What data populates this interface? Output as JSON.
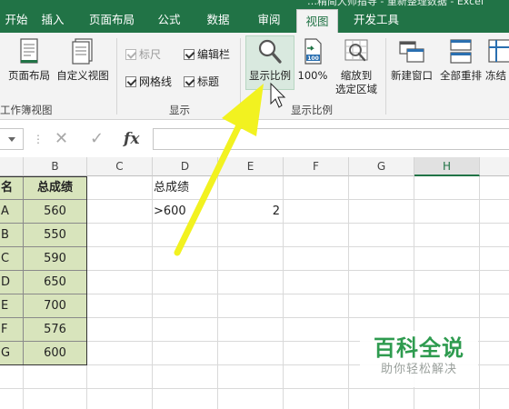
{
  "window": {
    "title": "…精简大师指导 - 重新整理数据 - Excel"
  },
  "tabs": [
    {
      "label": "开始",
      "active": false
    },
    {
      "label": "插入",
      "active": false
    },
    {
      "label": "页面布局",
      "active": false
    },
    {
      "label": "公式",
      "active": false
    },
    {
      "label": "数据",
      "active": false
    },
    {
      "label": "审阅",
      "active": false
    },
    {
      "label": "视图",
      "active": true
    },
    {
      "label": "开发工具",
      "active": false
    }
  ],
  "ribbon": {
    "workbook_views": {
      "page_layout_label": "页面布局",
      "custom_view_label": "自定义视图",
      "group_label": "工作簿视图"
    },
    "show": {
      "ruler_label": "标尺",
      "formula_bar_label": "编辑栏",
      "gridlines_label": "网格线",
      "headings_label": "标题",
      "group_label": "显示",
      "ruler_checked": true,
      "formula_bar_checked": true,
      "gridlines_checked": true,
      "headings_checked": true
    },
    "zoom": {
      "zoom_label": "显示比例",
      "zoom_100_label": "100%",
      "zoom_selection_line1": "缩放到",
      "zoom_selection_line2": "选定区域",
      "group_label": "显示比例"
    },
    "window": {
      "new_window_label": "新建窗口",
      "arrange_all_label": "全部重排",
      "freeze_label": "冻结"
    }
  },
  "formula_bar": {
    "fx_label": "fx",
    "name_box_value": "",
    "formula_value": ""
  },
  "grid": {
    "columns": [
      "B",
      "C",
      "D",
      "E",
      "F",
      "G",
      "H"
    ],
    "selected_column": "H",
    "rows": [
      {
        "a": "名",
        "b": "总成绩",
        "d": "总成绩",
        "e": ""
      },
      {
        "a": "A",
        "b": "560",
        "d": ">600",
        "e": "2"
      },
      {
        "a": "B",
        "b": "550",
        "d": "",
        "e": ""
      },
      {
        "a": "C",
        "b": "590",
        "d": "",
        "e": ""
      },
      {
        "a": "D",
        "b": "650",
        "d": "",
        "e": ""
      },
      {
        "a": "E",
        "b": "700",
        "d": "",
        "e": ""
      },
      {
        "a": "F",
        "b": "576",
        "d": "",
        "e": ""
      },
      {
        "a": "G",
        "b": "600",
        "d": "",
        "e": ""
      }
    ]
  },
  "watermark": {
    "title": "百科全说",
    "subtitle": "助你轻松解决"
  },
  "colors": {
    "excel_green": "#217346",
    "data_fill": "#d8e4bc",
    "arrow": "#f2f220",
    "watermark_green": "#2e9b4f"
  }
}
